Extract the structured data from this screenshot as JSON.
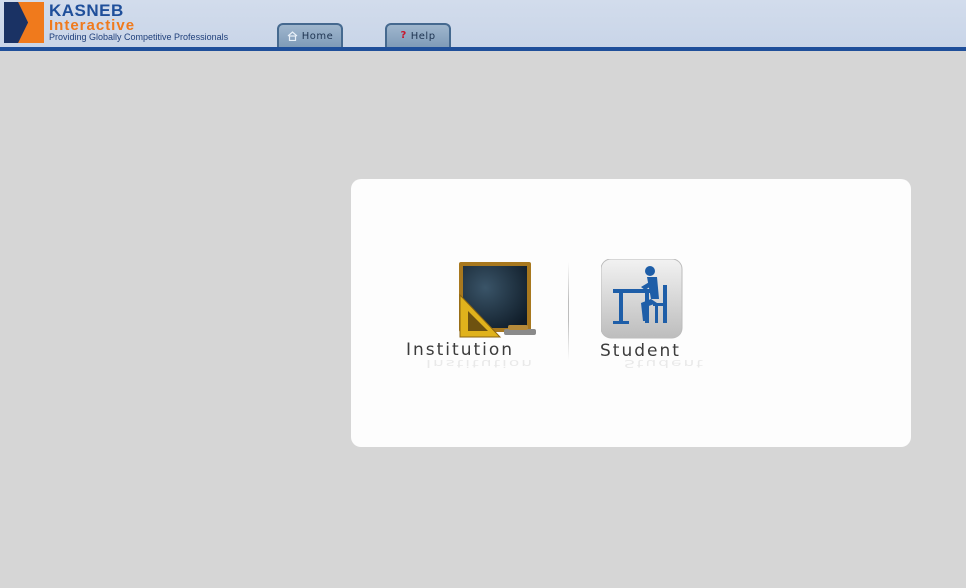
{
  "logo": {
    "title": "KASNEB",
    "subtitle": "Interactive",
    "tagline": "Providing Globally Competitive Professionals"
  },
  "tabs": {
    "home_label": "Home",
    "help_label": "Help",
    "help_symbol": "?"
  },
  "options": {
    "institution_label": "Institution",
    "student_label": "Student"
  },
  "colors": {
    "header_bg": "#ccd7e9",
    "header_border": "#1f4f9a",
    "brand_blue": "#1f4f9a",
    "brand_orange": "#f07a1c",
    "page_bg": "#d6d6d6"
  },
  "icons": {
    "logo": "kasneb-logo-icon",
    "home": "home-icon",
    "help": "help-icon",
    "institution": "blackboard-icon",
    "student": "student-desk-icon"
  }
}
